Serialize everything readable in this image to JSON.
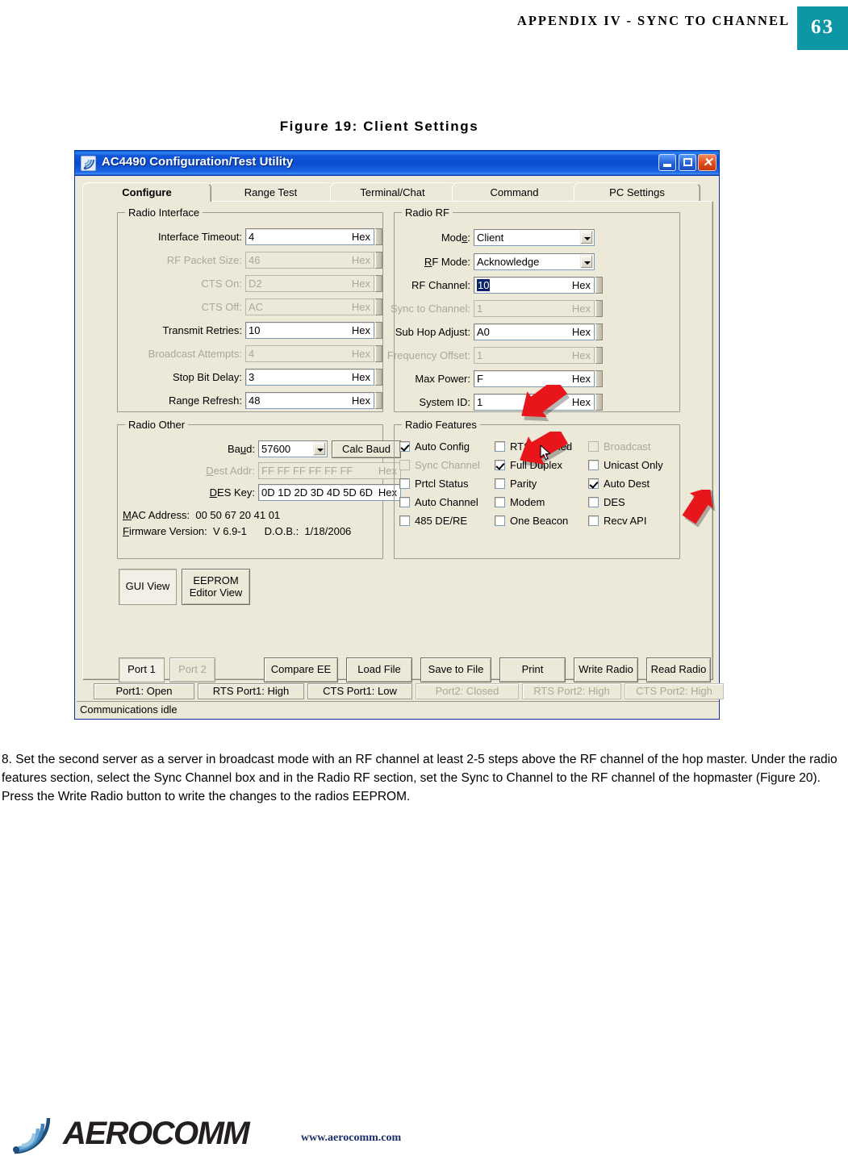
{
  "header": {
    "title": "APPENDIX IV - SYNC TO CHANNEL",
    "page_number": "63",
    "accent_color": "#0d96a4"
  },
  "figure": {
    "caption": "Figure 19: Client Settings"
  },
  "window": {
    "title": "AC4490 Configuration/Test Utility",
    "icon": "radio-signal-icon",
    "minimize_label": "",
    "maximize_label": "",
    "close_label": "✕"
  },
  "tabs": [
    {
      "label": "Configure",
      "active": true
    },
    {
      "label": "Range Test",
      "active": false
    },
    {
      "label": "Terminal/Chat",
      "active": false
    },
    {
      "label": "Command",
      "active": false
    },
    {
      "label": "PC Settings",
      "active": false
    }
  ],
  "radio_interface": {
    "title": "Radio Interface",
    "fields": [
      {
        "label": "Interface Timeout:",
        "value": "4",
        "suffix": "Hex",
        "disabled": false,
        "accel": "I"
      },
      {
        "label": "RF Packet Size:",
        "value": "46",
        "suffix": "Hex",
        "disabled": true,
        "accel": "k"
      },
      {
        "label": "CTS On:",
        "value": "D2",
        "suffix": "Hex",
        "disabled": true,
        "accel": "C"
      },
      {
        "label": "CTS Off:",
        "value": "AC",
        "suffix": "Hex",
        "disabled": true,
        "accel": "ff"
      },
      {
        "label": "Transmit Retries:",
        "value": "10",
        "suffix": "Hex",
        "disabled": false,
        "accel": "r"
      },
      {
        "label": "Broadcast Attempts:",
        "value": "4",
        "suffix": "Hex",
        "disabled": true,
        "accel": "o"
      },
      {
        "label": "Stop Bit Delay:",
        "value": "3",
        "suffix": "Hex",
        "disabled": false,
        "accel": "y"
      },
      {
        "label": "Range Refresh:",
        "value": "48",
        "suffix": "Hex",
        "disabled": false,
        "accel": ""
      }
    ]
  },
  "radio_rf": {
    "title": "Radio RF",
    "mode": {
      "label": "Mode:",
      "value": "Client",
      "type": "dropdown"
    },
    "rf_mode": {
      "label": "RF Mode:",
      "value": "Acknowledge",
      "type": "dropdown"
    },
    "fields": [
      {
        "label": "RF Channel:",
        "value": "10",
        "suffix": "Hex",
        "disabled": false,
        "selected": true
      },
      {
        "label": "Sync to Channel:",
        "value": "1",
        "suffix": "Hex",
        "disabled": true,
        "selected": false
      },
      {
        "label": "Sub Hop Adjust:",
        "value": "A0",
        "suffix": "Hex",
        "disabled": false,
        "selected": false
      },
      {
        "label": "Frequency Offset:",
        "value": "1",
        "suffix": "Hex",
        "disabled": true,
        "selected": false
      },
      {
        "label": "Max Power:",
        "value": "F",
        "suffix": "Hex",
        "disabled": false,
        "selected": false
      },
      {
        "label": "System ID:",
        "value": "1",
        "suffix": "Hex",
        "disabled": false,
        "selected": false
      }
    ]
  },
  "radio_other": {
    "title": "Radio Other",
    "baud_label": "Baud:",
    "baud_value": "57600",
    "calc_baud_label": "Calc Baud",
    "dest_addr_label": "Dest Addr:",
    "dest_addr_value": "FF FF FF FF FF FF",
    "dest_addr_suffix": "Hex",
    "des_key_label": "DES Key:",
    "des_key_value": "0D 1D 2D 3D 4D 5D 6D",
    "des_key_suffix": "Hex",
    "mac_address_label": "MAC Address:",
    "mac_address_value": "00 50 67 20 41 01",
    "firmware_label": "Firmware Version:",
    "firmware_value": "V 6.9-1",
    "dob_label": "D.O.B.:",
    "dob_value": "1/18/2006"
  },
  "radio_features": {
    "title": "Radio Features",
    "column1": [
      {
        "label": "Auto Config",
        "checked": true,
        "disabled": false
      },
      {
        "label": "Sync Channel",
        "checked": false,
        "disabled": true
      },
      {
        "label": "Prtcl Status",
        "checked": false,
        "disabled": false
      },
      {
        "label": "Auto Channel",
        "checked": false,
        "disabled": false
      },
      {
        "label": "485 DE/RE",
        "checked": false,
        "disabled": false
      }
    ],
    "column2": [
      {
        "label": "RTS Enabled",
        "checked": false,
        "disabled": false
      },
      {
        "label": "Full Duplex",
        "checked": true,
        "disabled": false
      },
      {
        "label": "Parity",
        "checked": false,
        "disabled": false
      },
      {
        "label": "Modem",
        "checked": false,
        "disabled": false
      },
      {
        "label": "One Beacon",
        "checked": false,
        "disabled": false
      }
    ],
    "column3": [
      {
        "label": "Broadcast",
        "checked": false,
        "disabled": true
      },
      {
        "label": "Unicast Only",
        "checked": false,
        "disabled": false
      },
      {
        "label": "Auto Dest",
        "checked": true,
        "disabled": false
      },
      {
        "label": "DES",
        "checked": false,
        "disabled": false
      },
      {
        "label": "Recv API",
        "checked": false,
        "disabled": false
      }
    ]
  },
  "view_buttons": [
    {
      "label": "GUI View",
      "pressed": true
    },
    {
      "label": "EEPROM\nEditor View",
      "pressed": false
    }
  ],
  "port_buttons": [
    {
      "label": "Port 1",
      "disabled": false,
      "pressed": true
    },
    {
      "label": "Port 2",
      "disabled": true,
      "pressed": false
    }
  ],
  "action_buttons": [
    {
      "label": "Compare EE"
    },
    {
      "label": "Load File"
    },
    {
      "label": "Save to File"
    },
    {
      "label": "Print"
    },
    {
      "label": "Write Radio"
    },
    {
      "label": "Read Radio"
    }
  ],
  "status_cells": [
    {
      "label": "Port1: Open",
      "disabled": false
    },
    {
      "label": "RTS Port1: High",
      "disabled": false
    },
    {
      "label": "CTS Port1: Low",
      "disabled": false
    },
    {
      "label": "Port2: Closed",
      "disabled": true
    },
    {
      "label": "RTS Port2: High",
      "disabled": true
    },
    {
      "label": "CTS Port2: High",
      "disabled": true
    }
  ],
  "status_message": "Communications idle",
  "body_copy": "8.  Set the second server as a server in broadcast mode with an RF channel at least 2-5 steps above the RF channel of the hop master.  Under the radio features section, select the Sync Channel box and in the Radio RF section, set the Sync to Channel to the RF channel of the hopmaster (Figure 20).  Press the Write Radio button to write the changes to the radios EEPROM.",
  "footer": {
    "wordmark": "AEROCOMM",
    "url": "www.aerocomm.com",
    "logo_color": "#4a90c4"
  }
}
